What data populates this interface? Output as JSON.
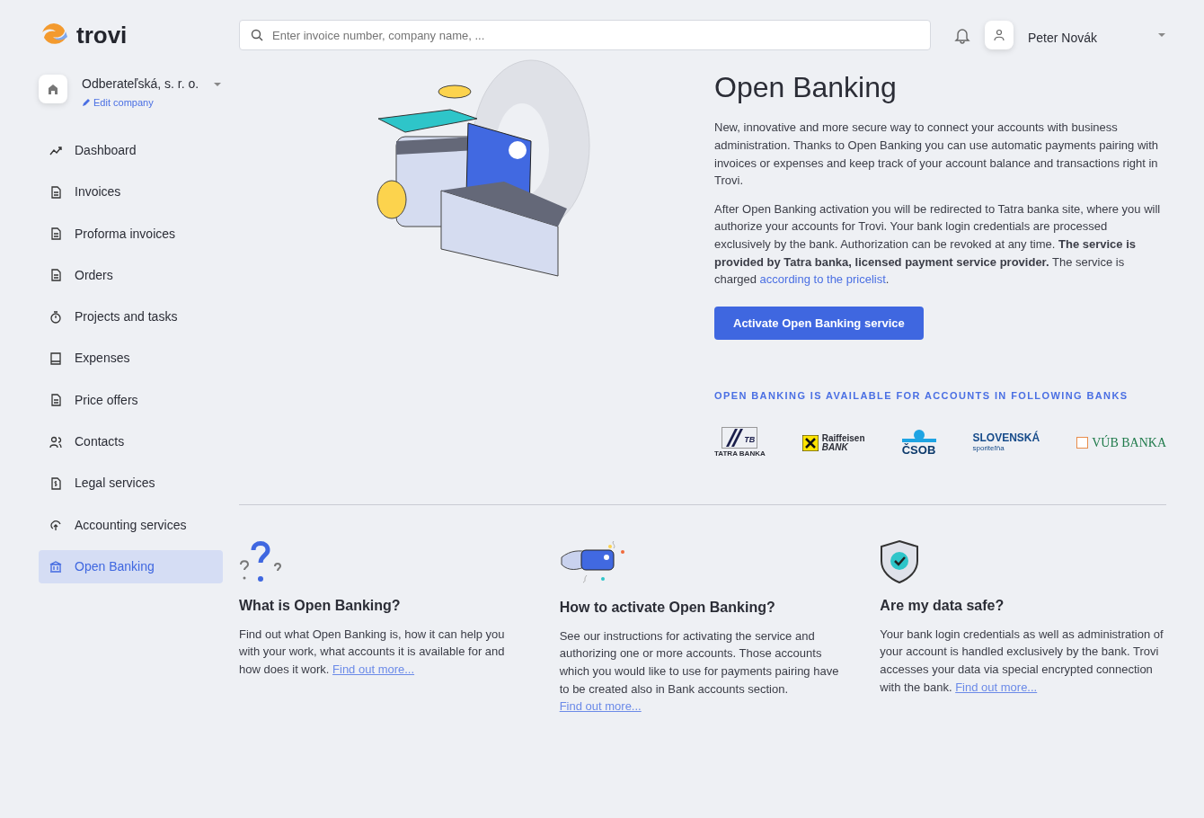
{
  "brand": {
    "name": "trovi"
  },
  "company": {
    "name": "Odberateľská, s. r. o.",
    "edit_label": "Edit company"
  },
  "search": {
    "placeholder": "Enter invoice number, company name, ..."
  },
  "user": {
    "name": "Peter Novák"
  },
  "sidebar": {
    "items": [
      {
        "label": "Dashboard",
        "selected": false
      },
      {
        "label": "Invoices",
        "selected": false
      },
      {
        "label": "Proforma invoices",
        "selected": false
      },
      {
        "label": "Orders",
        "selected": false
      },
      {
        "label": "Projects and tasks",
        "selected": false
      },
      {
        "label": "Expenses",
        "selected": false
      },
      {
        "label": "Price offers",
        "selected": false
      },
      {
        "label": "Contacts",
        "selected": false
      },
      {
        "label": "Legal services",
        "selected": false
      },
      {
        "label": "Accounting services",
        "selected": false
      },
      {
        "label": "Open Banking",
        "selected": true
      }
    ]
  },
  "hero": {
    "title": "Open Banking",
    "paragraph_1": "New, innovative and more secure way to connect your accounts with business administration. Thanks to Open Banking you can use automatic payments pairing with invoices or expenses and keep track of your account balance and transactions right in Trovi.",
    "paragraph_2": {
      "text": "After Open Banking activation you will be redirected to Tatra banka site, where you will authorize your accounts for Trovi. Your bank login credentials are processed exclusively by the bank. Authorization can be revoked at any time. **The service is provided by Tatra banka, licensed payment service provider.** The service is charged",
      "link": "according to the pricelist",
      "after": "."
    },
    "button": "Activate Open Banking service",
    "banks_heading": "OPEN BANKING IS AVAILABLE FOR ACCOUNTS IN FOLLOWING BANKS",
    "banks": [
      {
        "kind": "tatra",
        "lines": [
          "TB",
          "TATRA BANKA"
        ]
      },
      {
        "kind": "raiffeisen",
        "lines": [
          "Raiffeisen",
          "BANK"
        ]
      },
      {
        "kind": "csob",
        "lines": [
          "ČSOB"
        ]
      },
      {
        "kind": "slsp",
        "lines": [
          "SLOVENSKÁ",
          "sporiteľňa"
        ]
      },
      {
        "kind": "vub",
        "lines": [
          "VÚB BANKA"
        ]
      }
    ]
  },
  "features": [
    {
      "kind": "question",
      "title": "What is Open Banking?",
      "text": "Find out what Open Banking is, how it can help you with your work, what accounts it is available for and how does it work.",
      "link": "Find out more..."
    },
    {
      "kind": "card",
      "title": "How to activate Open Banking?",
      "text": "See our instructions for activating the service and authorizing one or more accounts. Those accounts which you would like to use for payments pairing have to be created also in Bank accounts section.",
      "link": "Find out more..."
    },
    {
      "kind": "shield",
      "title": "Are my data safe?",
      "text": "Your bank login credentials as well as administration of your account is handled exclusively by the bank. Trovi accesses your data via special encrypted connection with the bank.",
      "link": "Find out more..."
    }
  ]
}
